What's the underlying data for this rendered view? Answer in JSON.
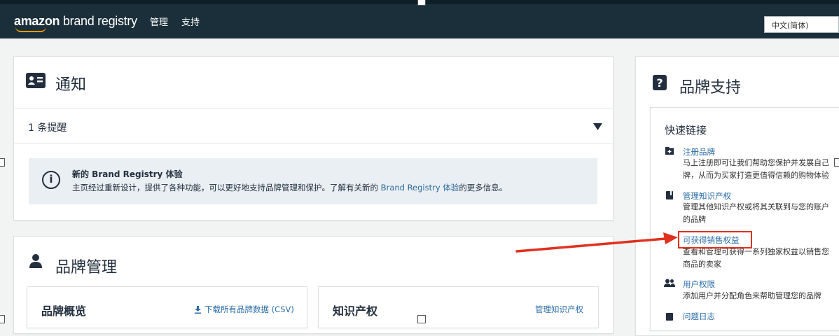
{
  "header": {
    "logo_amazon": "amazon",
    "logo_rest": " brand registry",
    "nav": [
      "管理",
      "支持"
    ],
    "language": "中文(简体)"
  },
  "notifications": {
    "title": "通知",
    "alerts_summary": "1 条提醒",
    "info_title": "新的 Brand Registry 体验",
    "info_text_before": "主页经过重新设计，提供了各种功能，可以更好地支持品牌管理和保护。了解有关新的 ",
    "info_link": "Brand Registry 体验",
    "info_text_after": "的更多信息。"
  },
  "brand_management": {
    "title": "品牌管理",
    "overview_title": "品牌概览",
    "download_link": "下载所有品牌数据 (CSV)",
    "ip_title": "知识产权",
    "manage_ip_link": "管理知识产权"
  },
  "brand_support": {
    "title": "品牌支持",
    "quick_links_title": "快速链接",
    "links": [
      {
        "label": "注册品牌",
        "desc": [
          "马上注册即可让我们帮助您保护并发展自己",
          "牌，从而为买家打造更值得信赖的购物体验"
        ],
        "icon": "add-folder-icon"
      },
      {
        "label": "管理知识产权",
        "desc": [
          "管理其他知识产权或将其关联到与您的账户",
          "的品牌"
        ],
        "icon": "book-icon"
      },
      {
        "label": "可获得销售权益",
        "desc": [
          "查看和管理可获得一系列独家权益以销售您",
          "商品的卖家"
        ],
        "icon": "none"
      },
      {
        "label": "用户权限",
        "desc": [
          "添加用户并分配角色来帮助管理您的品牌"
        ],
        "icon": "users-icon"
      },
      {
        "label": "问题日志",
        "desc": [],
        "icon": "log-icon"
      }
    ]
  },
  "colors": {
    "header_bg": "#1b2f3a",
    "link": "#2b6ca8",
    "highlight": "#e0311f",
    "accent": "#ff9900"
  }
}
